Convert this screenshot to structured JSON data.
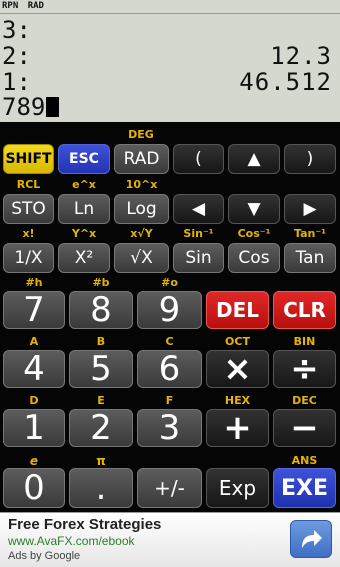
{
  "status": {
    "mode": "RPN",
    "angle": "RAD"
  },
  "stack": [
    {
      "label": "3:",
      "value": ""
    },
    {
      "label": "2:",
      "value": "12.3"
    },
    {
      "label": "1:",
      "value": "46.512"
    }
  ],
  "input": {
    "value": "789"
  },
  "secondary": {
    "deg": "DEG",
    "rcl": "RCL",
    "eX": "e^x",
    "tenX": "10^x",
    "fact": "x!",
    "yx": "Y^x",
    "xrooty": "x√Y",
    "asin": "Sin⁻¹",
    "acos": "Cos⁻¹",
    "atan": "Tan⁻¹",
    "h": "#h",
    "b": "#b",
    "o": "#o",
    "A": "A",
    "B": "B",
    "C": "C",
    "oct": "OCT",
    "bin": "BIN",
    "D": "D",
    "E": "E",
    "F": "F",
    "hex": "HEX",
    "dec": "DEC",
    "e": "e",
    "pi": "π",
    "ans": "ANS"
  },
  "keys": {
    "shift": "SHIFT",
    "esc": "ESC",
    "rad": "RAD",
    "lparen": "(",
    "up": "▲",
    "rparen": ")",
    "sto": "STO",
    "ln": "Ln",
    "log": "Log",
    "left": "◀",
    "down": "▼",
    "right": "▶",
    "inv": "1/X",
    "sq": "X²",
    "sqrt": "√X",
    "sin": "Sin",
    "cos": "Cos",
    "tan": "Tan",
    "n7": "7",
    "n8": "8",
    "n9": "9",
    "del": "DEL",
    "clr": "CLR",
    "n4": "4",
    "n5": "5",
    "n6": "6",
    "mul": "×",
    "div": "÷",
    "n1": "1",
    "n2": "2",
    "n3": "3",
    "add": "+",
    "sub": "−",
    "n0": "0",
    "dot": ".",
    "neg": "+/-",
    "exp": "Exp",
    "exe": "EXE"
  },
  "ad": {
    "title": "Free Forex Strategies",
    "url": "www.AvaFX.com/ebook",
    "by": "Ads by Google",
    "button_icon": "share-arrow-icon"
  }
}
